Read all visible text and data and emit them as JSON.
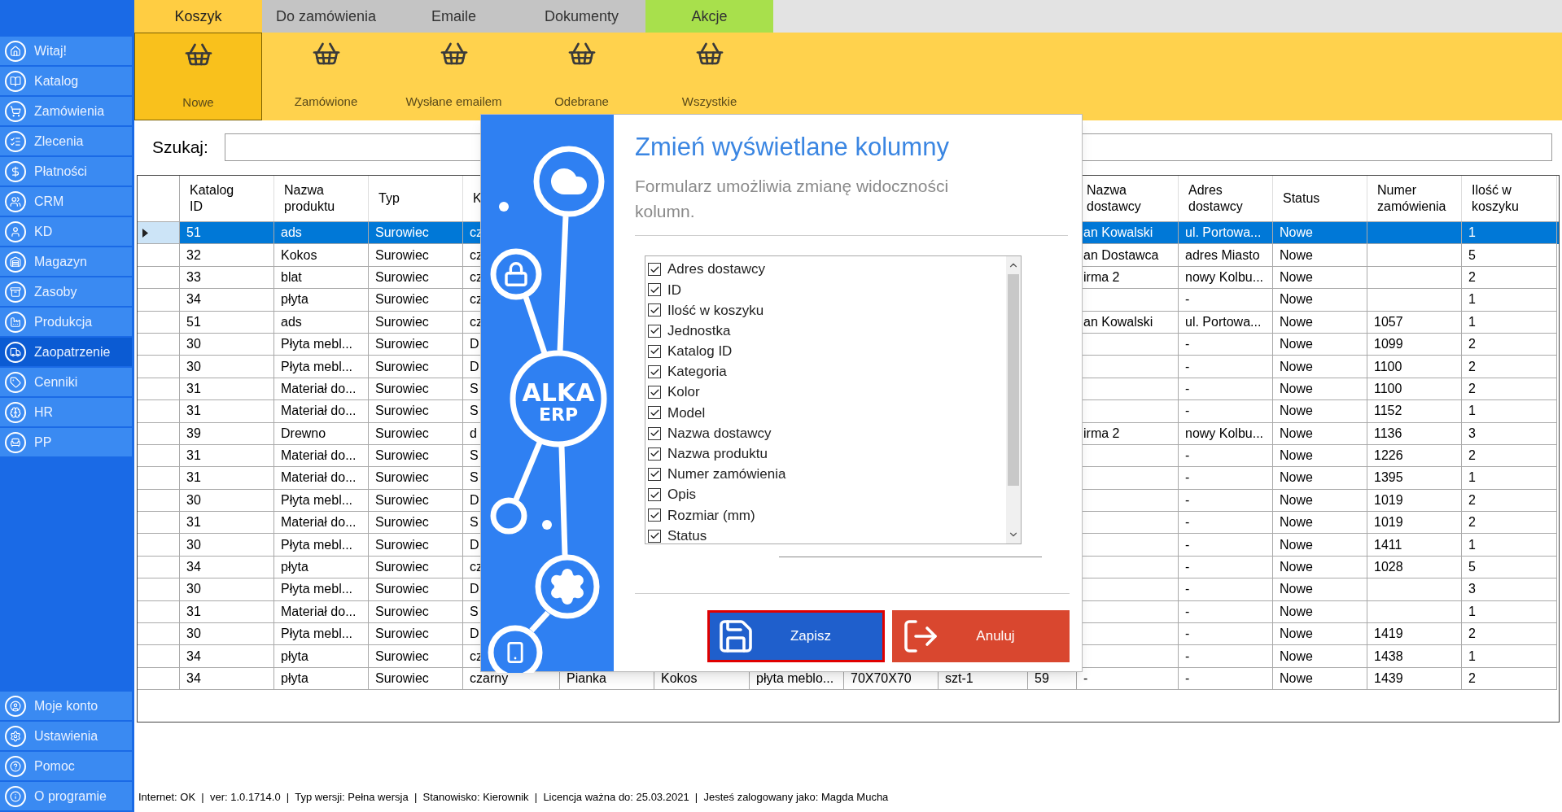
{
  "sidebar": {
    "items": [
      {
        "label": "Witaj!",
        "selected": false
      },
      {
        "label": "Katalog",
        "selected": false
      },
      {
        "label": "Zamówienia",
        "selected": false
      },
      {
        "label": "Zlecenia",
        "selected": false
      },
      {
        "label": "Płatności",
        "selected": false
      },
      {
        "label": "CRM",
        "selected": false
      },
      {
        "label": "KD",
        "selected": false
      },
      {
        "label": "Magazyn",
        "selected": false
      },
      {
        "label": "Zasoby",
        "selected": false
      },
      {
        "label": "Produkcja",
        "selected": false
      },
      {
        "label": "Zaopatrzenie",
        "selected": true
      },
      {
        "label": "Cenniki",
        "selected": false
      },
      {
        "label": "HR",
        "selected": false
      },
      {
        "label": "PP",
        "selected": false
      }
    ],
    "bottom_items": [
      {
        "label": "Moje konto"
      },
      {
        "label": "Ustawienia"
      },
      {
        "label": "Pomoc"
      },
      {
        "label": "O programie"
      }
    ]
  },
  "tabs": [
    {
      "label": "Koszyk",
      "selected": true,
      "color": "#ffcd42"
    },
    {
      "label": "Do zamówienia",
      "selected": false,
      "color": "#c4c4c4"
    },
    {
      "label": "Emaile",
      "selected": false,
      "color": "#c4c4c4"
    },
    {
      "label": "Dokumenty",
      "selected": false,
      "color": "#c4c4c4"
    },
    {
      "label": "Akcje",
      "selected": false,
      "color": "#a8e04c"
    }
  ],
  "toolbar": [
    {
      "label": "Nowe",
      "selected": true
    },
    {
      "label": "Zamówione",
      "selected": false
    },
    {
      "label": "Wysłane emailem",
      "selected": false
    },
    {
      "label": "Odebrane",
      "selected": false
    },
    {
      "label": "Wszystkie",
      "selected": false
    }
  ],
  "search": {
    "label": "Szukaj:"
  },
  "table": {
    "columns": [
      "Katalog\nID",
      "Nazwa\nproduktu",
      "Typ",
      "K",
      null,
      null,
      null,
      null,
      null,
      null,
      "Nazwa\ndostawcy",
      "Adres\ndostawcy",
      "Status",
      "Numer\nzamówienia",
      "Ilość w\nkoszyku"
    ],
    "rows": [
      {
        "selected": true,
        "cells": [
          "51",
          "ads",
          "Surowiec",
          "cz",
          null,
          null,
          null,
          null,
          null,
          null,
          "an Kowalski",
          "ul. Portowa...",
          "Nowe",
          null,
          "1"
        ]
      },
      {
        "selected": false,
        "cells": [
          "32",
          "Kokos",
          "Surowiec",
          "cz",
          null,
          null,
          null,
          null,
          null,
          null,
          "an Dostawca",
          "adres Miasto",
          "Nowe",
          null,
          "5"
        ]
      },
      {
        "selected": false,
        "cells": [
          "33",
          "blat",
          "Surowiec",
          "cz",
          null,
          null,
          null,
          null,
          null,
          null,
          "irma 2",
          "nowy Kolbu...",
          "Nowe",
          null,
          "2"
        ]
      },
      {
        "selected": false,
        "cells": [
          "34",
          "płyta",
          "Surowiec",
          "cz",
          null,
          null,
          null,
          null,
          null,
          null,
          null,
          "-",
          "Nowe",
          null,
          "1"
        ]
      },
      {
        "selected": false,
        "cells": [
          "51",
          "ads",
          "Surowiec",
          "cz",
          null,
          null,
          null,
          null,
          null,
          null,
          "an Kowalski",
          "ul. Portowa...",
          "Nowe",
          "1057",
          "1"
        ]
      },
      {
        "selected": false,
        "cells": [
          "30",
          "Płyta mebl...",
          "Surowiec",
          "D",
          null,
          null,
          null,
          null,
          null,
          null,
          null,
          "-",
          "Nowe",
          "1099",
          "2"
        ]
      },
      {
        "selected": false,
        "cells": [
          "30",
          "Płyta mebl...",
          "Surowiec",
          "D",
          null,
          null,
          null,
          null,
          null,
          null,
          null,
          "-",
          "Nowe",
          "1100",
          "2"
        ]
      },
      {
        "selected": false,
        "cells": [
          "31",
          "Materiał do...",
          "Surowiec",
          "S",
          null,
          null,
          null,
          null,
          null,
          null,
          null,
          "-",
          "Nowe",
          "1100",
          "2"
        ]
      },
      {
        "selected": false,
        "cells": [
          "31",
          "Materiał do...",
          "Surowiec",
          "S",
          null,
          null,
          null,
          null,
          null,
          null,
          null,
          "-",
          "Nowe",
          "1152",
          "1"
        ]
      },
      {
        "selected": false,
        "cells": [
          "39",
          "Drewno",
          "Surowiec",
          "d",
          null,
          null,
          null,
          null,
          null,
          null,
          "irma 2",
          "nowy Kolbu...",
          "Nowe",
          "1136",
          "3"
        ]
      },
      {
        "selected": false,
        "cells": [
          "31",
          "Materiał do...",
          "Surowiec",
          "S",
          null,
          null,
          null,
          null,
          null,
          null,
          null,
          "-",
          "Nowe",
          "1226",
          "2"
        ]
      },
      {
        "selected": false,
        "cells": [
          "31",
          "Materiał do...",
          "Surowiec",
          "S",
          null,
          null,
          null,
          null,
          null,
          null,
          null,
          "-",
          "Nowe",
          "1395",
          "1"
        ]
      },
      {
        "selected": false,
        "cells": [
          "30",
          "Płyta mebl...",
          "Surowiec",
          "D",
          null,
          null,
          null,
          null,
          null,
          null,
          null,
          "-",
          "Nowe",
          "1019",
          "2"
        ]
      },
      {
        "selected": false,
        "cells": [
          "31",
          "Materiał do...",
          "Surowiec",
          "S",
          null,
          null,
          null,
          null,
          null,
          null,
          null,
          "-",
          "Nowe",
          "1019",
          "2"
        ]
      },
      {
        "selected": false,
        "cells": [
          "30",
          "Płyta mebl...",
          "Surowiec",
          "D",
          null,
          null,
          null,
          null,
          null,
          null,
          null,
          "-",
          "Nowe",
          "1411",
          "1"
        ]
      },
      {
        "selected": false,
        "cells": [
          "34",
          "płyta",
          "Surowiec",
          "cz",
          null,
          null,
          null,
          null,
          null,
          null,
          null,
          "-",
          "Nowe",
          "1028",
          "5"
        ]
      },
      {
        "selected": false,
        "cells": [
          "30",
          "Płyta mebl...",
          "Surowiec",
          "D",
          null,
          null,
          null,
          null,
          null,
          null,
          null,
          "-",
          "Nowe",
          null,
          "3"
        ]
      },
      {
        "selected": false,
        "cells": [
          "31",
          "Materiał do...",
          "Surowiec",
          "S",
          null,
          null,
          null,
          null,
          null,
          null,
          null,
          "-",
          "Nowe",
          null,
          "1"
        ]
      },
      {
        "selected": false,
        "cells": [
          "30",
          "Płyta mebl...",
          "Surowiec",
          "D",
          null,
          null,
          null,
          null,
          null,
          null,
          null,
          "-",
          "Nowe",
          "1419",
          "2"
        ]
      },
      {
        "selected": false,
        "cells": [
          "34",
          "płyta",
          "Surowiec",
          "cz",
          null,
          null,
          null,
          null,
          null,
          null,
          null,
          "-",
          "Nowe",
          "1438",
          "1"
        ]
      },
      {
        "selected": false,
        "cells": [
          "34",
          "płyta",
          "Surowiec",
          "czarny",
          "Pianka",
          "Kokos",
          "płyta meblo...",
          "70X70X70",
          "szt-1",
          "59",
          "-",
          "-",
          "Nowe",
          "1439",
          "2"
        ]
      }
    ]
  },
  "dialog": {
    "logo": [
      "ALKA",
      "ERP"
    ],
    "title": "Zmień wyświetlane kolumny",
    "description": "Formularz umożliwia zmianę widoczności kolumn.",
    "options": [
      {
        "label": "Adres dostawcy",
        "checked": true
      },
      {
        "label": "ID",
        "checked": true
      },
      {
        "label": "Ilość w koszyku",
        "checked": true
      },
      {
        "label": "Jednostka",
        "checked": true
      },
      {
        "label": "Katalog ID",
        "checked": true
      },
      {
        "label": "Kategoria",
        "checked": true
      },
      {
        "label": "Kolor",
        "checked": true
      },
      {
        "label": "Model",
        "checked": true
      },
      {
        "label": "Nazwa dostawcy",
        "checked": true
      },
      {
        "label": "Nazwa produktu",
        "checked": true
      },
      {
        "label": "Numer zamówienia",
        "checked": true
      },
      {
        "label": "Opis",
        "checked": true
      },
      {
        "label": "Rozmiar (mm)",
        "checked": true
      },
      {
        "label": "Status",
        "checked": true
      }
    ],
    "buttons": [
      {
        "label": "Zapisz",
        "kind": "save"
      },
      {
        "label": "Anuluj",
        "kind": "cancel"
      }
    ]
  },
  "status_bar": "Internet: OK  |  ver: 1.0.1714.0  |  Typ wersji: Pełna wersja  |  Stanowisko: Kierownik  |  Licencja ważna do: 25.03.2021  |  Jesteś zalogowany jako: Magda Mucha"
}
